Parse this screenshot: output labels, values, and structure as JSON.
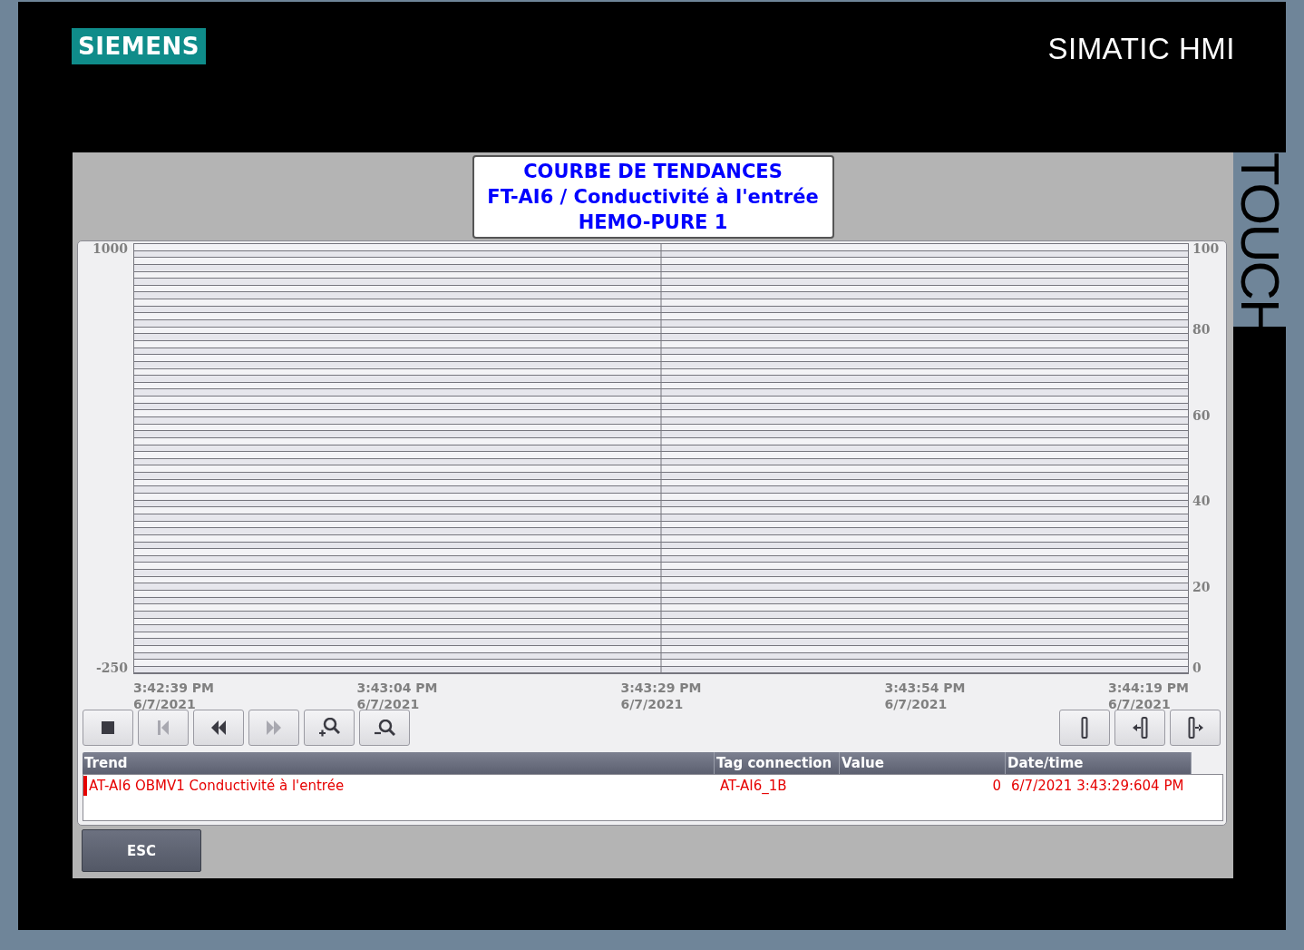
{
  "brand": {
    "logo": "SIEMENS",
    "product": "SIMATIC HMI",
    "side_label": "TOUCH"
  },
  "title_box": {
    "lines": [
      "COURBE DE TENDANCES",
      "FT-AI6 / Conductivité à l'entrée",
      "HEMO-PURE 1"
    ]
  },
  "trend_view": {
    "left_axis": [
      "1000",
      "-250"
    ],
    "right_axis": [
      "100",
      "80",
      "60",
      "40",
      "20",
      "0"
    ],
    "time_axis": [
      {
        "time": "3:42:39 PM",
        "date": "6/7/2021"
      },
      {
        "time": "3:43:04 PM",
        "date": "6/7/2021"
      },
      {
        "time": "3:43:29 PM",
        "date": "6/7/2021"
      },
      {
        "time": "3:43:54 PM",
        "date": "6/7/2021"
      },
      {
        "time": "3:44:19 PM",
        "date": "6/7/2021"
      }
    ],
    "toolbar_left": [
      {
        "kind": "stop",
        "disabled": false
      },
      {
        "kind": "first",
        "disabled": true
      },
      {
        "kind": "back",
        "disabled": false
      },
      {
        "kind": "forward",
        "disabled": true
      },
      {
        "kind": "zoom-in",
        "disabled": false
      },
      {
        "kind": "zoom-out",
        "disabled": false
      }
    ],
    "toolbar_right": [
      {
        "kind": "ruler",
        "disabled": false
      },
      {
        "kind": "ruler-left",
        "disabled": false
      },
      {
        "kind": "ruler-right",
        "disabled": false
      }
    ],
    "table": {
      "columns": [
        "Trend",
        "Tag connection",
        "Value",
        "Date/time"
      ],
      "rows": [
        {
          "trend": "AT-AI6 OBMV1 Conductivité à l'entrée",
          "tag": "AT-AI6_1B",
          "value": "0",
          "datetime": "6/7/2021 3:43:29:604 PM",
          "color": "#e60000"
        }
      ]
    }
  },
  "buttons": [
    {
      "label": "ESC"
    }
  ]
}
